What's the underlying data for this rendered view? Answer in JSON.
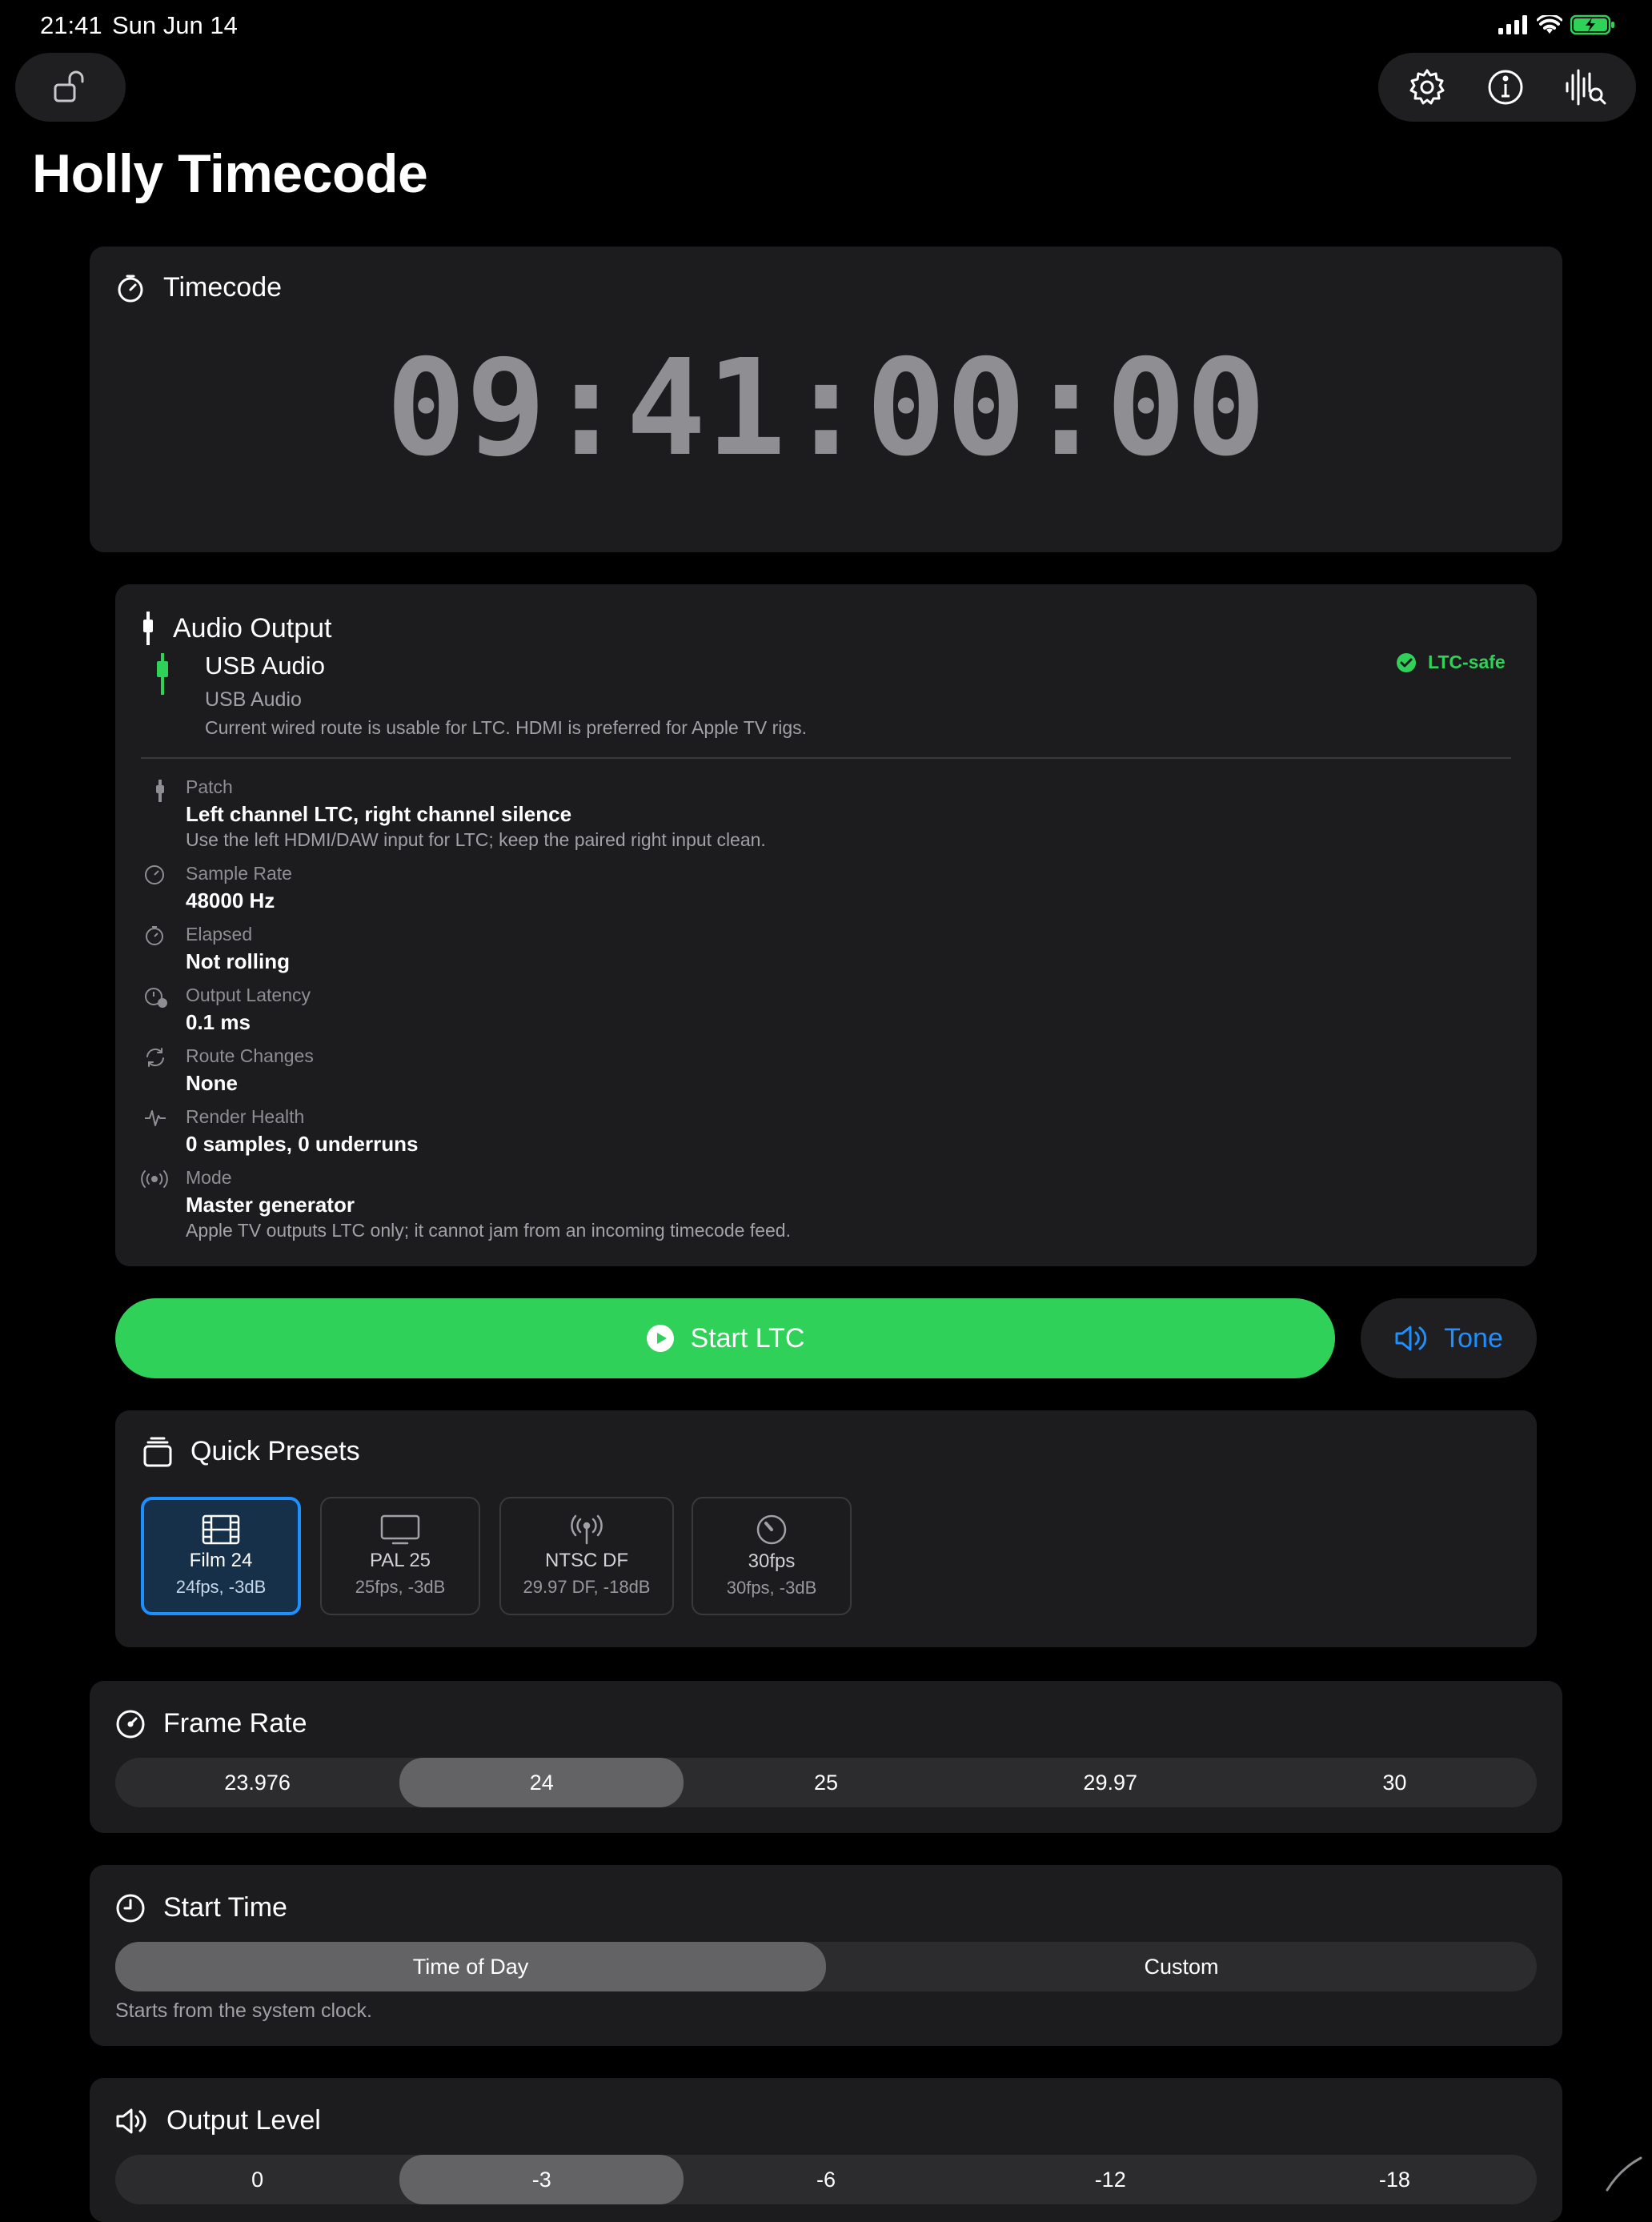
{
  "status_bar": {
    "time": "21:41",
    "date": "Sun Jun 14"
  },
  "app": {
    "title": "Holly Timecode"
  },
  "timecode": {
    "heading": "Timecode",
    "value": "09:41:00:00"
  },
  "audio_output": {
    "heading": "Audio Output",
    "device_name": "USB Audio",
    "device_type": "USB Audio",
    "device_note": "Current wired route is usable for LTC. HDMI is preferred for Apple TV rigs.",
    "badge": "LTC-safe",
    "rows": [
      {
        "label": "Patch",
        "value": "Left channel LTC, right channel silence",
        "note": "Use the left HDMI/DAW input for LTC; keep the paired right input clean."
      },
      {
        "label": "Sample Rate",
        "value": "48000 Hz",
        "note": ""
      },
      {
        "label": "Elapsed",
        "value": "Not rolling",
        "note": ""
      },
      {
        "label": "Output Latency",
        "value": "0.1 ms",
        "note": ""
      },
      {
        "label": "Route Changes",
        "value": "None",
        "note": ""
      },
      {
        "label": "Render Health",
        "value": "0 samples, 0 underruns",
        "note": ""
      },
      {
        "label": "Mode",
        "value": "Master generator",
        "note": "Apple TV outputs LTC only; it cannot jam from an incoming timecode feed."
      }
    ]
  },
  "actions": {
    "start_label": "Start LTC",
    "tone_label": "Tone"
  },
  "presets": {
    "heading": "Quick Presets",
    "items": [
      {
        "name": "Film 24",
        "detail": "24fps, -3dB",
        "icon": "film-icon"
      },
      {
        "name": "PAL 25",
        "detail": "25fps, -3dB",
        "icon": "tv-icon"
      },
      {
        "name": "NTSC DF",
        "detail": "29.97 DF, -18dB",
        "icon": "broadcast-icon"
      },
      {
        "name": "30fps",
        "detail": "30fps, -3dB",
        "icon": "gauge-icon"
      }
    ],
    "selected_index": 0
  },
  "frame_rate": {
    "heading": "Frame Rate",
    "options": [
      "23.976",
      "24",
      "25",
      "29.97",
      "30"
    ],
    "selected_index": 1
  },
  "start_time": {
    "heading": "Start Time",
    "options": [
      "Time of Day",
      "Custom"
    ],
    "selected_index": 0,
    "note": "Starts from the system clock."
  },
  "output_level": {
    "heading": "Output Level",
    "options": [
      "0",
      "-3",
      "-6",
      "-12",
      "-18"
    ],
    "selected_index": 1
  },
  "colors": {
    "accent_green": "#30d158",
    "accent_blue": "#1e8fff",
    "card": "#1c1c1e",
    "muted": "#8e8e93"
  }
}
